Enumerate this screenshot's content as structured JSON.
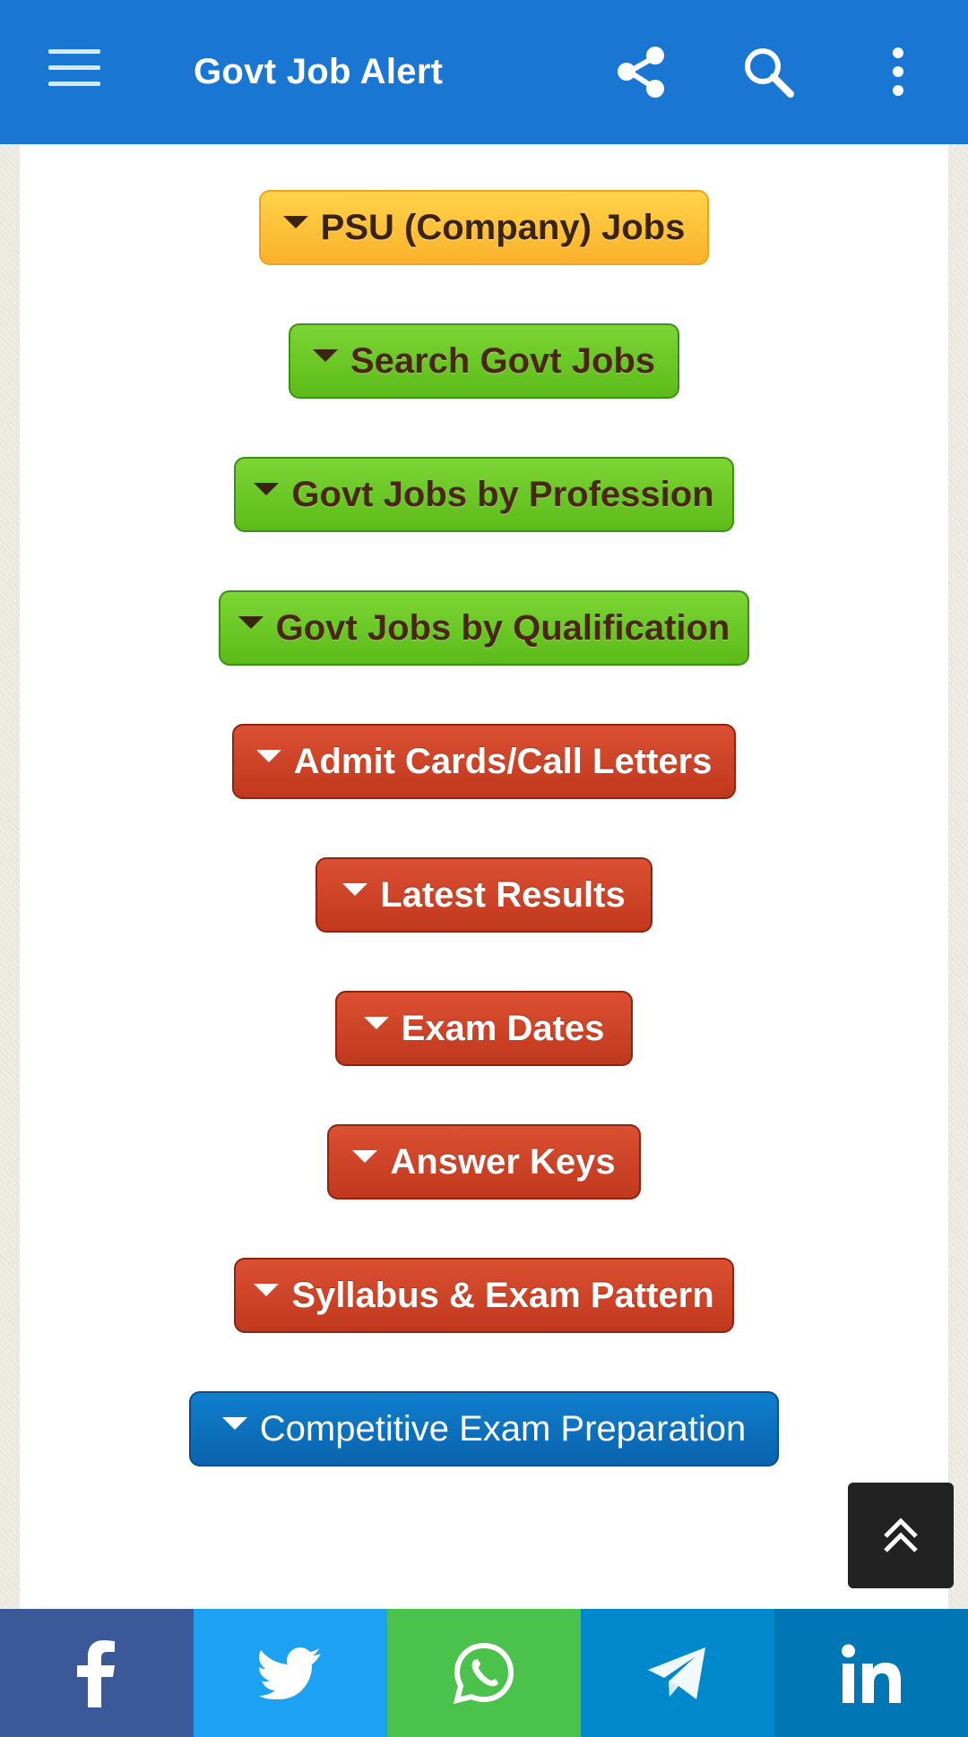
{
  "appbar": {
    "title": "Govt Job Alert",
    "color": "#1976d2",
    "icons": [
      "menu-icon",
      "share-icon",
      "search-icon",
      "more-vertical-icon"
    ]
  },
  "menu": {
    "buttons": [
      {
        "label": "PSU (Company) Jobs",
        "style": "yellow"
      },
      {
        "label": "Search Govt Jobs",
        "style": "green"
      },
      {
        "label": "Govt Jobs by Profession",
        "style": "green"
      },
      {
        "label": "Govt Jobs by Qualification",
        "style": "green"
      },
      {
        "label": "Admit Cards/Call Letters",
        "style": "red"
      },
      {
        "label": "Latest Results",
        "style": "red"
      },
      {
        "label": "Exam Dates",
        "style": "red"
      },
      {
        "label": "Answer Keys",
        "style": "red"
      },
      {
        "label": "Syllabus & Exam Pattern",
        "style": "red"
      },
      {
        "label": "Competitive Exam Preparation",
        "style": "blue"
      }
    ]
  },
  "back_to_top": {
    "icon": "double-chevron-up-icon"
  },
  "share_bar": {
    "items": [
      {
        "name": "facebook",
        "icon": "facebook-icon",
        "color": "#3b5998"
      },
      {
        "name": "twitter",
        "icon": "twitter-icon",
        "color": "#1da1f2"
      },
      {
        "name": "whatsapp",
        "icon": "whatsapp-icon",
        "color": "#4bc24c"
      },
      {
        "name": "telegram",
        "icon": "telegram-icon",
        "color": "#0088cc"
      },
      {
        "name": "linkedin",
        "icon": "linkedin-icon",
        "color": "#0077b5"
      }
    ]
  }
}
